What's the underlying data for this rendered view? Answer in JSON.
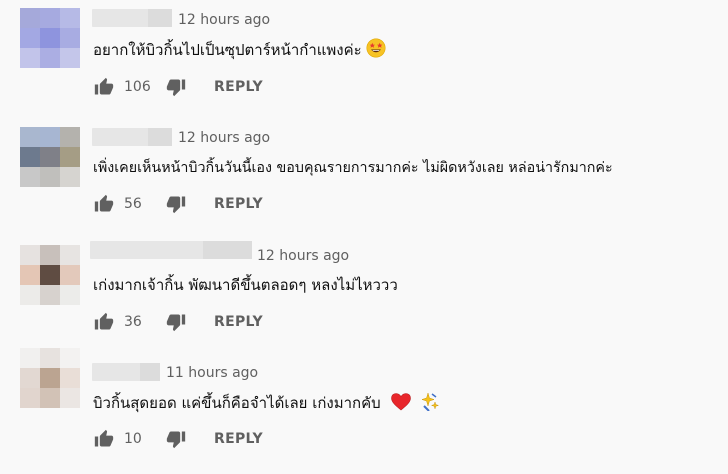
{
  "comments": [
    {
      "time": "12 hours ago",
      "text": "อยากให้บิวกิ้นไปเป็นซุปตาร์หน้ากำแพงค่ะ",
      "emoji": "star-struck-emoji",
      "likes": "106",
      "reply_label": "REPLY",
      "avatar_colors": [
        "#a5a9da",
        "#a6aae0",
        "#b6bae6",
        "#a3a8e3",
        "#8e94de",
        "#a8ace2",
        "#c2c4ea",
        "#abaee3",
        "#c4c6ea"
      ]
    },
    {
      "time": "12 hours ago",
      "text": "เพิ่งเคยเห็นหน้าบิวกิ้นวันนี้เอง ขอบคุณรายการมากค่ะ ไม่ผิดหวังเลย หล่อน่ารักมากค่ะ",
      "likes": "56",
      "reply_label": "REPLY",
      "avatar_colors": [
        "#a9b7cf",
        "#a7b6d2",
        "#b4b2ad",
        "#6d7a8e",
        "#7f8088",
        "#a59d85",
        "#c8c8c8",
        "#c0bfbc",
        "#d6d4d0"
      ]
    },
    {
      "time": "12 hours ago",
      "text": "เก่งมากเจ้ากิ้น พัฒนาดีขึ้นตลอดๆ หลงไม่ไหววว",
      "likes": "36",
      "reply_label": "REPLY",
      "avatar_colors": [
        "#e6e2e0",
        "#c8c0bb",
        "#e7e4e2",
        "#e4c6b5",
        "#5f4c42",
        "#e3c9bb",
        "#ecebe9",
        "#d7d2ce",
        "#ececea"
      ]
    },
    {
      "time": "11 hours ago",
      "text": "บิวกิ้นสุดยอด แค่ขึ้นก็คือจำได้เลย เก่งมากคับ",
      "emoji": "heart-and-sparkles-emoji",
      "likes": "10",
      "reply_label": "REPLY",
      "avatar_colors": [
        "#f1f0ef",
        "#e7e2df",
        "#f3f2f1",
        "#e2d8d2",
        "#bba491",
        "#e9ded7",
        "#e1d5ce",
        "#d2c2b6",
        "#ebe6e3"
      ]
    }
  ],
  "colors": {
    "background": "#f9f9f9",
    "text": "#0f0f0f",
    "secondary": "#606060",
    "heart": "#e8262b"
  }
}
